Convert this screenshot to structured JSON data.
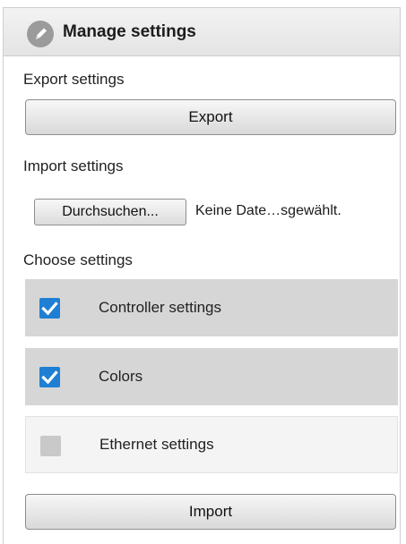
{
  "header": {
    "title": "Manage settings",
    "icon": "pencil-icon"
  },
  "export": {
    "section_label": "Export settings",
    "button_label": "Export"
  },
  "import_file": {
    "section_label": "Import settings",
    "browse_label": "Durchsuchen...",
    "status_text": "Keine Date…sgewählt."
  },
  "choose": {
    "section_label": "Choose settings",
    "options": [
      {
        "label": "Controller settings",
        "checked": true
      },
      {
        "label": "Colors",
        "checked": true
      },
      {
        "label": "Ethernet settings",
        "checked": false
      }
    ]
  },
  "import": {
    "button_label": "Import"
  },
  "colors": {
    "accent": "#1e7fd4",
    "checked_row": "#d6d6d6",
    "unchecked_row": "#f4f4f4"
  }
}
